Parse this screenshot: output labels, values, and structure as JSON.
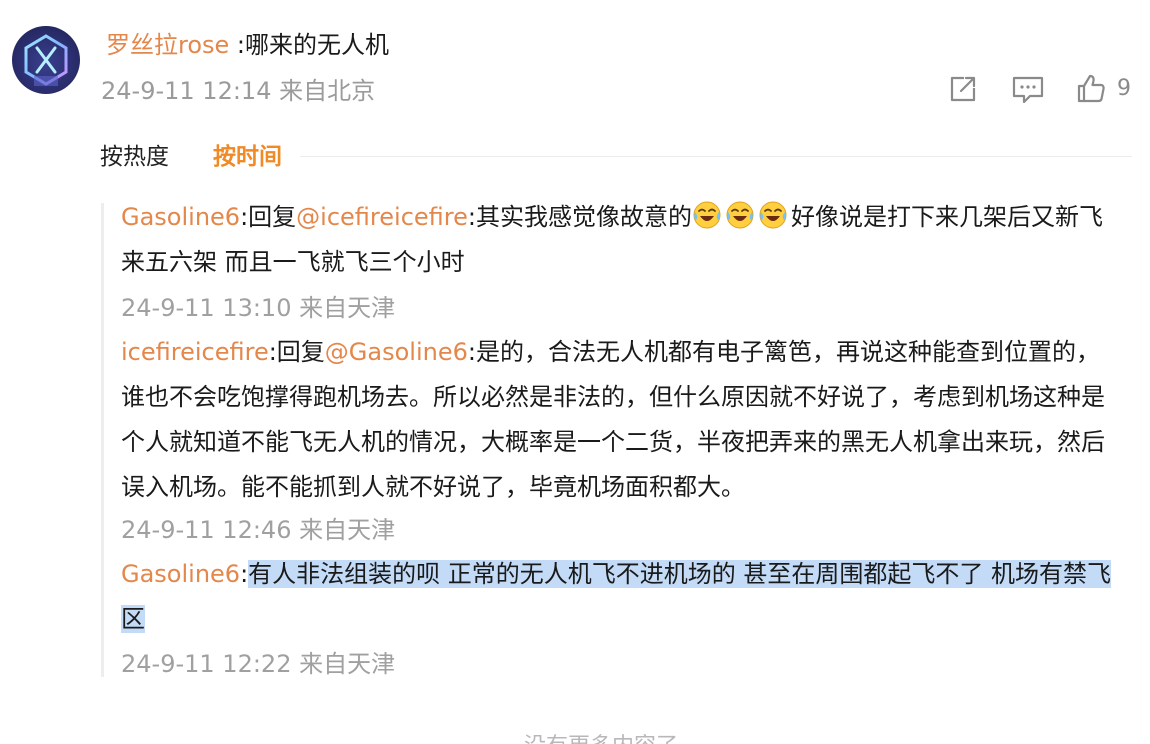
{
  "comment": {
    "username": "罗丝拉rose",
    "separator": " :",
    "text": "哪来的无人机",
    "timestamp": "24-9-11 12:14",
    "location": "来自北京",
    "like_count": "9",
    "icons": [
      "share-icon",
      "comment-icon",
      "like-icon"
    ]
  },
  "sort_tabs": {
    "hot": "按热度",
    "time": "按时间",
    "active": "time"
  },
  "replies": [
    {
      "name": "Gasoline6",
      "prefix": ":回复",
      "mention": "@icefireicefire",
      "colon": ":",
      "text_before_emoji": "其实我感觉像故意的",
      "emojis": [
        "laugh-cry-emoji",
        "laugh-cry-emoji",
        "laugh-cry-emoji"
      ],
      "text_after_emoji": "好像说是打下来几架后又新飞来五六架 而且一飞就飞三个小时",
      "timestamp": "24-9-11 13:10",
      "location": "来自天津"
    },
    {
      "name": "icefireicefire",
      "prefix": ":回复",
      "mention": "@Gasoline6",
      "colon": ":",
      "text": "是的，合法无人机都有电子篱笆，再说这种能查到位置的，谁也不会吃饱撑得跑机场去。所以必然是非法的，但什么原因就不好说了，考虑到机场这种是个人就知道不能飞无人机的情况，大概率是一个二货，半夜把弄来的黑无人机拿出来玩，然后误入机场。能不能抓到人就不好说了，毕竟机场面积都大。",
      "timestamp": "24-9-11 12:46",
      "location": "来自天津"
    },
    {
      "name": "Gasoline6",
      "colon": ":",
      "text": "有人非法组装的呗 正常的无人机飞不进机场的 甚至在周围都起飞不了 机场有禁飞区",
      "highlighted": true,
      "timestamp": "24-9-11 12:22",
      "location": "来自天津"
    }
  ],
  "bottom_partial_text": "没有更多内容了",
  "colors": {
    "username": "#e4874b",
    "active_tab": "#f08a24",
    "meta": "#9b9b9b",
    "highlight": "#c3dbf7"
  }
}
